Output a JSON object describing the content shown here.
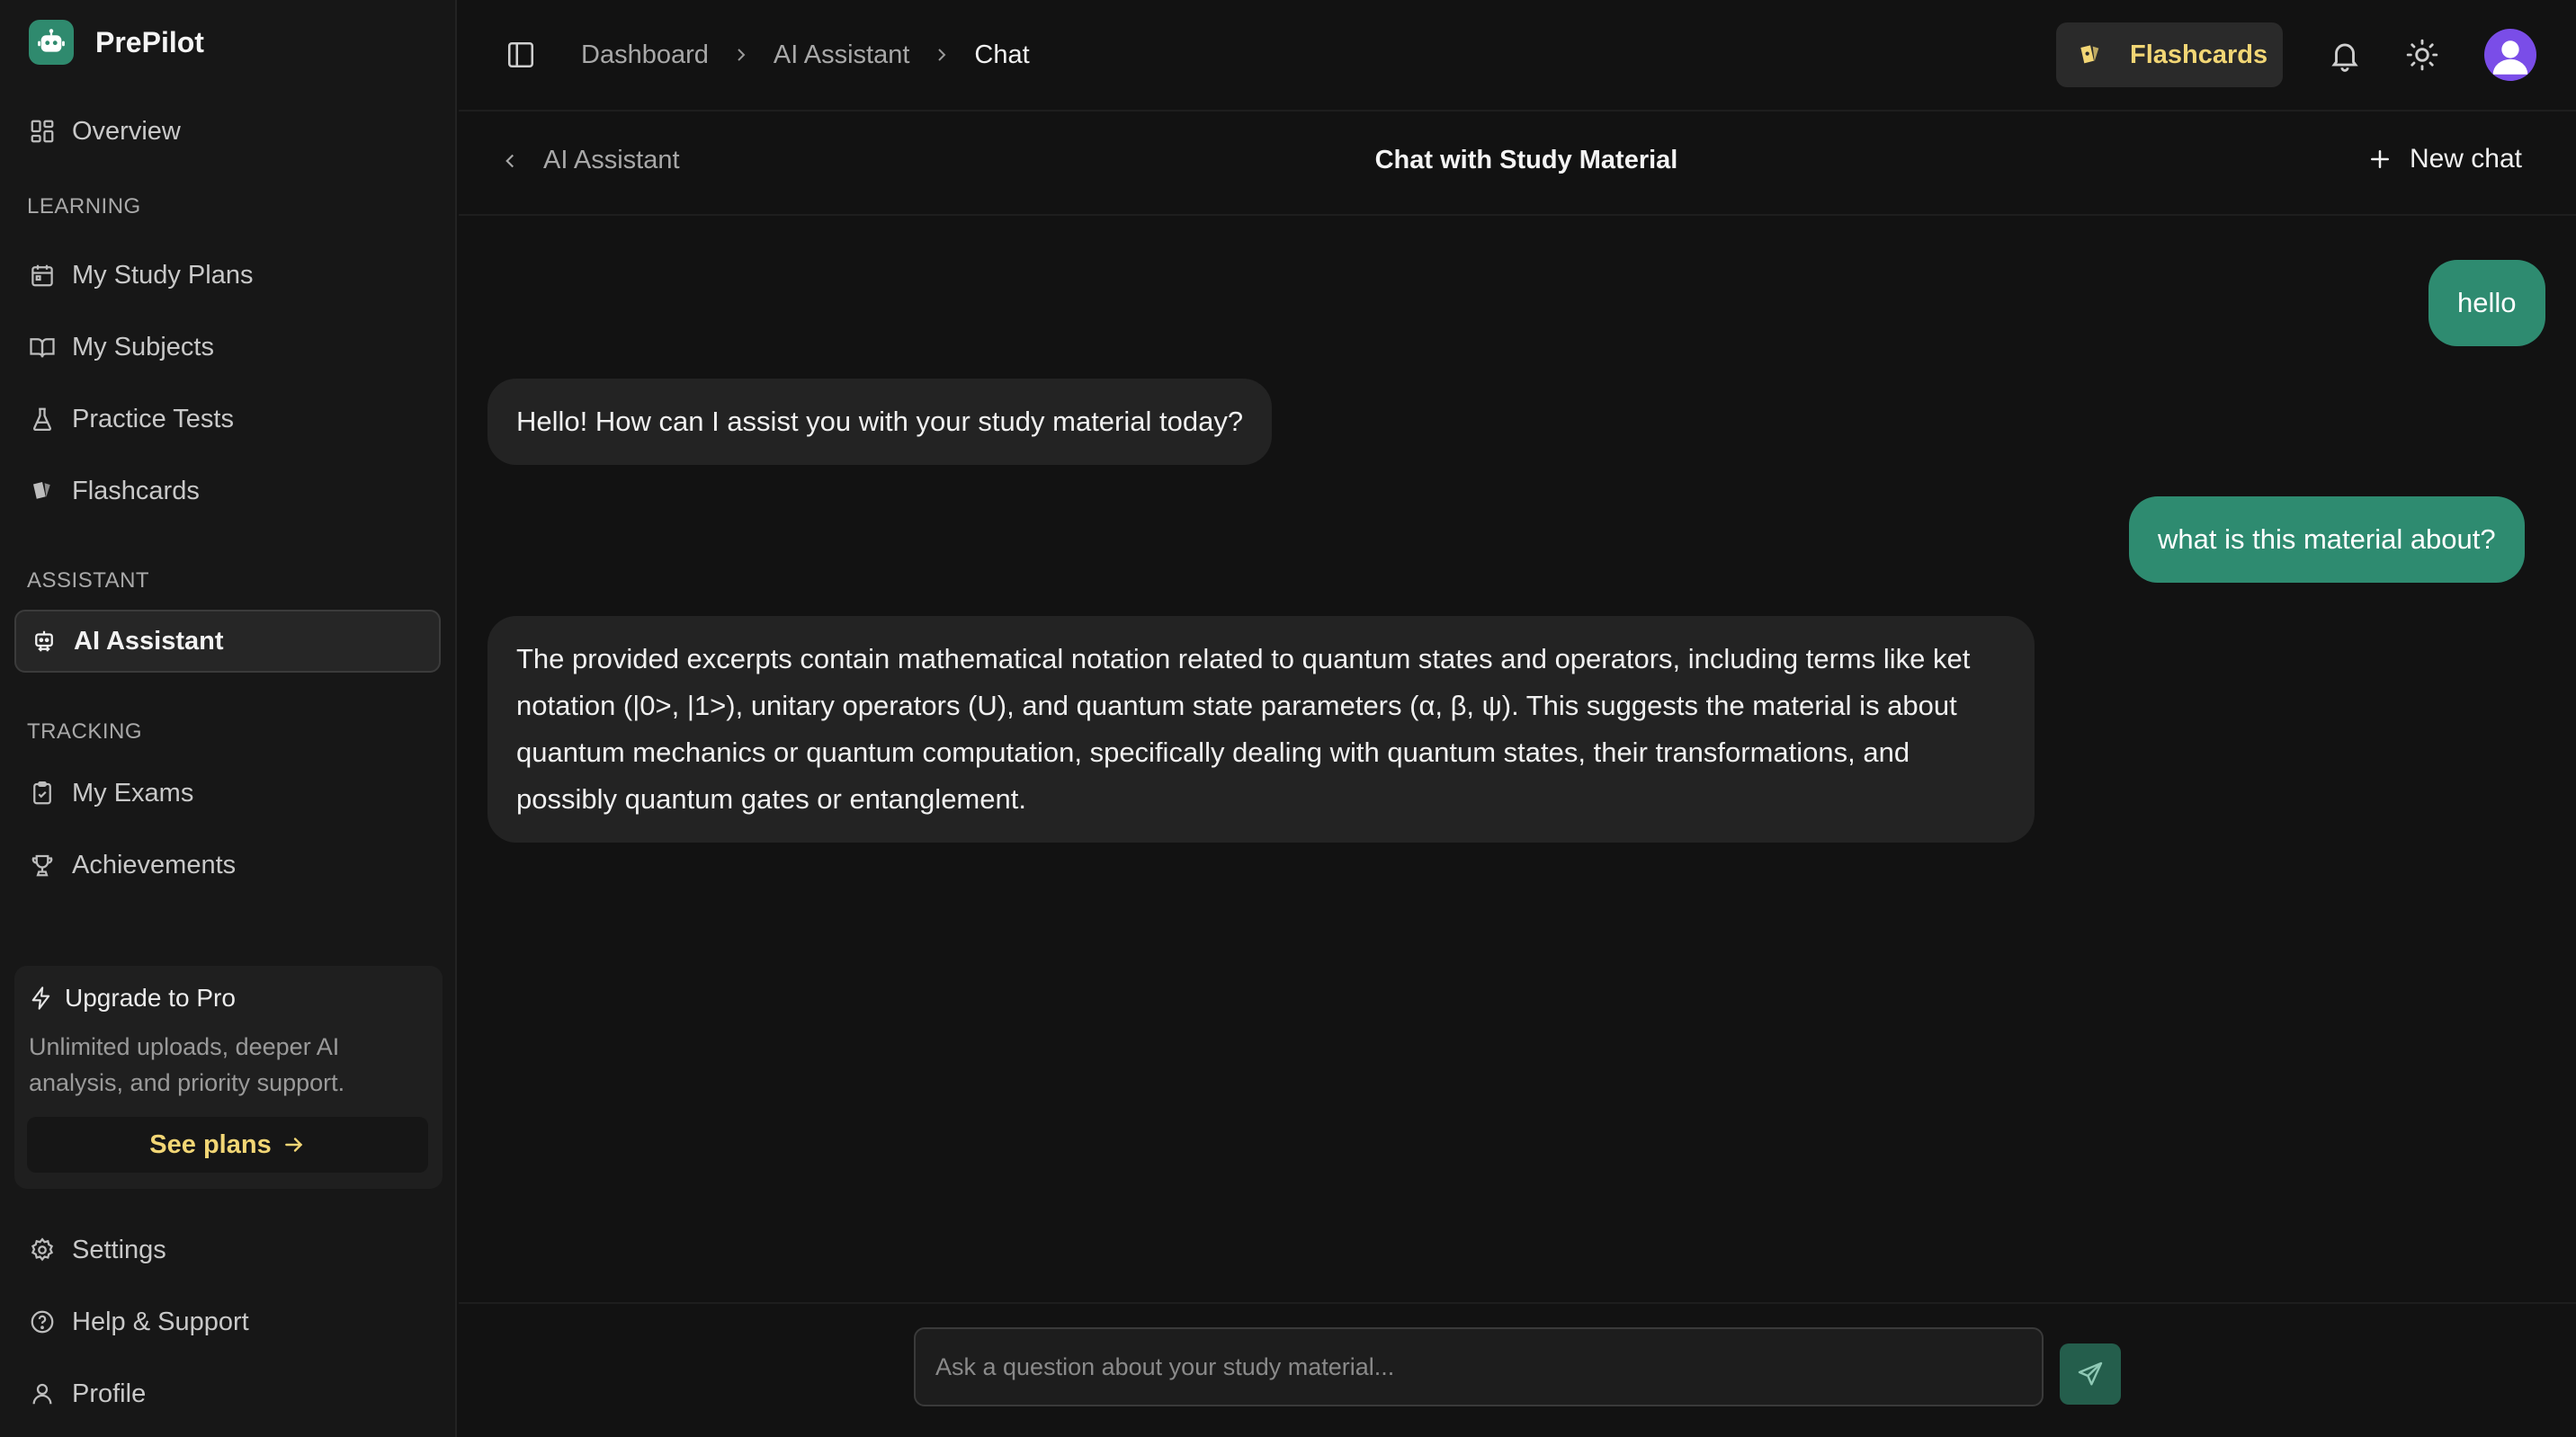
{
  "app": {
    "name": "PrePilot"
  },
  "sidebar": {
    "overview": "Overview",
    "sections": {
      "learning": "LEARNING",
      "assistant": "ASSISTANT",
      "tracking": "TRACKING"
    },
    "learning_items": [
      "My Study Plans",
      "My Subjects",
      "Practice Tests",
      "Flashcards"
    ],
    "assistant_items": [
      "AI Assistant"
    ],
    "tracking_items": [
      "My Exams",
      "Achievements"
    ],
    "bottom_items": [
      "Settings",
      "Help & Support",
      "Profile"
    ],
    "active_item": "AI Assistant",
    "promo": {
      "title": "Upgrade to Pro",
      "text": "Unlimited uploads, deeper AI analysis, and priority support.",
      "button": "See plans"
    }
  },
  "topbar": {
    "breadcrumb": [
      "Dashboard",
      "AI Assistant",
      "Chat"
    ],
    "flashcards_button": "Flashcards"
  },
  "chat": {
    "back_label": "AI Assistant",
    "title": "Chat with Study Material",
    "new_chat_label": "New chat",
    "messages": [
      {
        "role": "user",
        "text": "hello"
      },
      {
        "role": "assistant",
        "text": "Hello! How can I assist you with your study material today?"
      },
      {
        "role": "user",
        "text": "what is this material about?"
      },
      {
        "role": "assistant",
        "text": "The provided excerpts contain mathematical notation related to quantum states and operators, including terms like ket notation (|0>, |1>), unitary operators (U), and quantum state parameters (α, β, ψ). This suggests the material is about quantum mechanics or quantum computation, specifically dealing with quantum states, their transformations, and possibly quantum gates or entanglement."
      }
    ],
    "input": {
      "placeholder": "Ask a question about your study material...",
      "value": ""
    }
  },
  "colors": {
    "background": "#121212",
    "sidebar": "#171717",
    "accent_green": "#2e8b70",
    "accent_yellow": "#f2d675",
    "avatar": "#7a4de8"
  }
}
